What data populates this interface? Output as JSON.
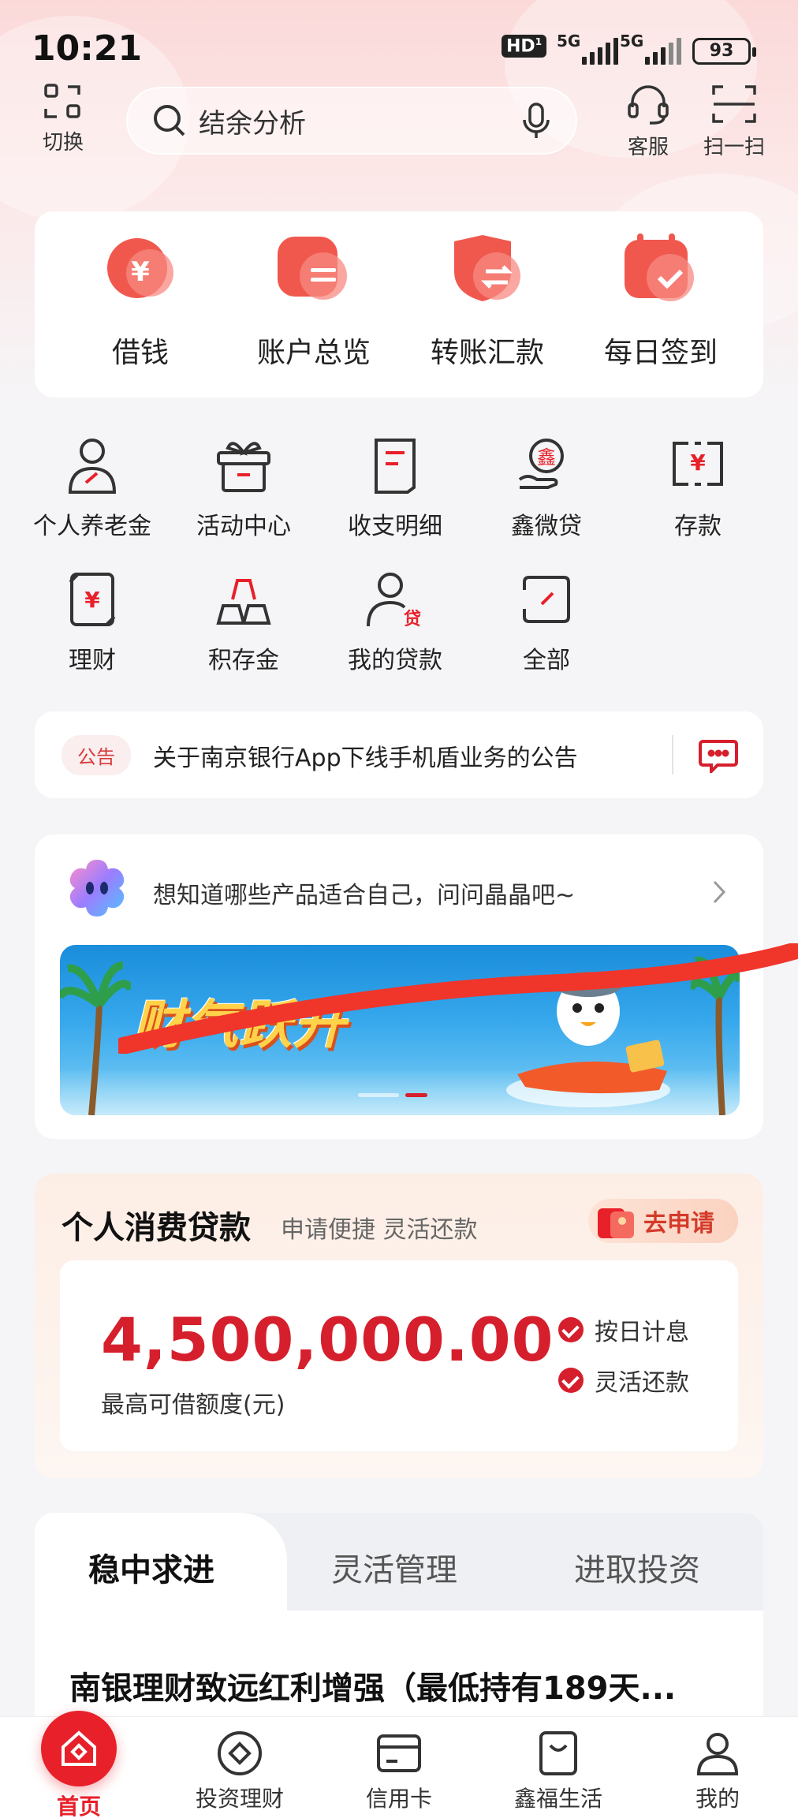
{
  "status_bar": {
    "time": "10:21",
    "hd": "HD",
    "network1": "5G",
    "network2": "5G",
    "battery": "93"
  },
  "header": {
    "switch_label": "切换",
    "search_placeholder": "结余分析",
    "service_label": "客服",
    "scan_label": "扫一扫"
  },
  "quick_actions": [
    {
      "label": "借钱",
      "icon": "yuan-icon"
    },
    {
      "label": "账户总览",
      "icon": "equal-icon"
    },
    {
      "label": "转账汇款",
      "icon": "transfer-icon"
    },
    {
      "label": "每日签到",
      "icon": "calendar-check-icon"
    }
  ],
  "grid": [
    {
      "label": "个人养老金",
      "icon": "person-icon"
    },
    {
      "label": "活动中心",
      "icon": "gift-icon"
    },
    {
      "label": "收支明细",
      "icon": "document-icon"
    },
    {
      "label": "鑫微贷",
      "icon": "hand-coin-icon",
      "glyph": "鑫"
    },
    {
      "label": "存款",
      "icon": "deposit-icon",
      "glyph": "¥"
    },
    {
      "label": "理财",
      "icon": "finance-icon",
      "glyph": "¥"
    },
    {
      "label": "积存金",
      "icon": "gold-bars-icon"
    },
    {
      "label": "我的贷款",
      "icon": "person-loan-icon",
      "glyph": "贷"
    },
    {
      "label": "全部",
      "icon": "all-icon"
    }
  ],
  "notice": {
    "tag": "公告",
    "text": "关于南京银行App下线手机盾业务的公告"
  },
  "assistant": {
    "text": "想知道哪些产品适合自己，问问晶晶吧~"
  },
  "banner": {
    "text": "财气跃升"
  },
  "loan": {
    "title": "个人消费贷款",
    "subtitle": "申请便捷 灵活还款",
    "apply_label": "去申请",
    "amount": "4,500,000.00",
    "amount_label": "最高可借额度(元)",
    "features": [
      "按日计息",
      "灵活还款"
    ]
  },
  "tabs": {
    "items": [
      "稳中求进",
      "灵活管理",
      "进取投资"
    ],
    "active": 0,
    "product_title": "南银理财致远红利增强（最低持有189天..."
  },
  "bottom_nav": [
    {
      "label": "首页",
      "icon": "home-icon",
      "active": true
    },
    {
      "label": "投资理财",
      "icon": "diamond-icon"
    },
    {
      "label": "信用卡",
      "icon": "card-icon"
    },
    {
      "label": "鑫福生活",
      "icon": "bag-icon"
    },
    {
      "label": "我的",
      "icon": "user-icon"
    }
  ],
  "colors": {
    "accent": "#e8202a",
    "amount": "#d61f2c",
    "background": "#f5f5f7"
  }
}
